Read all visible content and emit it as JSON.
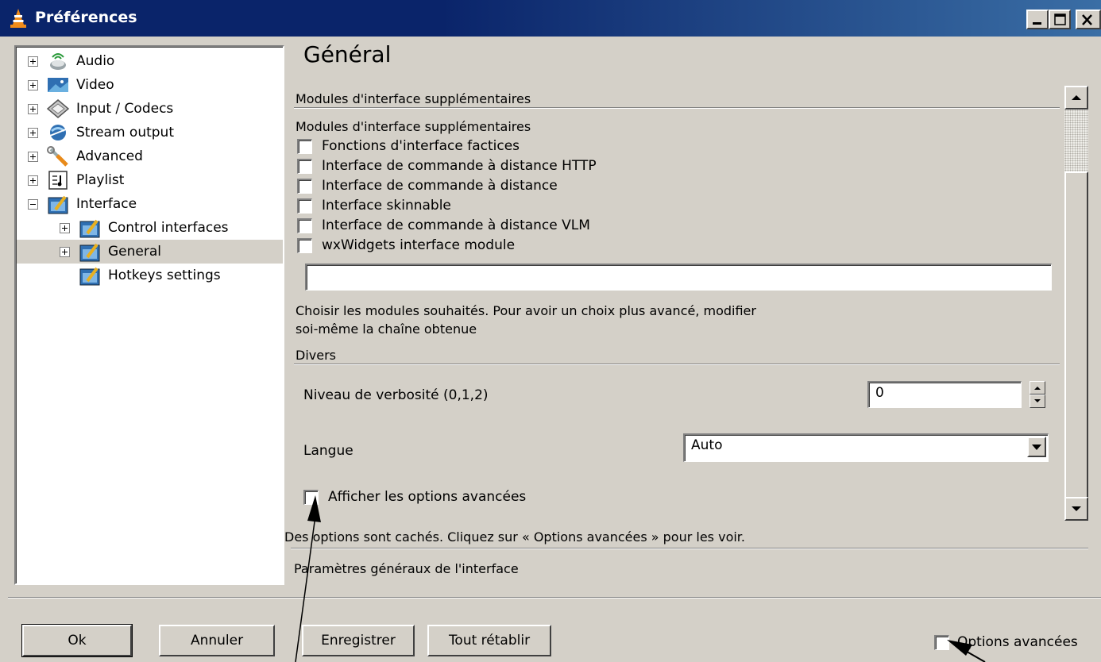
{
  "window": {
    "title": "Préférences",
    "icon": "vlc-cone-icon",
    "controls": [
      "minimize-icon",
      "maximize-icon",
      "close-icon"
    ]
  },
  "tree": {
    "items": [
      {
        "label": "Audio",
        "icon": "audio-icon",
        "expander": "plus",
        "level": 0
      },
      {
        "label": "Video",
        "icon": "video-icon",
        "expander": "plus",
        "level": 0
      },
      {
        "label": "Input / Codecs",
        "icon": "codecs-icon",
        "expander": "plus",
        "level": 0
      },
      {
        "label": "Stream output",
        "icon": "stream-output-icon",
        "expander": "plus",
        "level": 0
      },
      {
        "label": "Advanced",
        "icon": "advanced-icon",
        "expander": "plus",
        "level": 0
      },
      {
        "label": "Playlist",
        "icon": "playlist-icon",
        "expander": "plus",
        "level": 0
      },
      {
        "label": "Interface",
        "icon": "interface-icon",
        "expander": "minus",
        "level": 0
      },
      {
        "label": "Control interfaces",
        "icon": "interface-icon",
        "expander": "plus",
        "level": 1
      },
      {
        "label": "General",
        "icon": "interface-icon",
        "expander": "plus",
        "level": 1,
        "selected": true
      },
      {
        "label": "Hotkeys settings",
        "icon": "interface-icon",
        "expander": "none",
        "level": 1
      }
    ]
  },
  "panel": {
    "heading": "Général",
    "section1_title": "Modules d'interface supplémentaires",
    "modules_label": "Modules d'interface supplémentaires",
    "modules": [
      {
        "label": "Fonctions d'interface factices",
        "checked": false
      },
      {
        "label": "Interface de commande à distance HTTP",
        "checked": false
      },
      {
        "label": "Interface de commande à distance",
        "checked": false
      },
      {
        "label": "Interface skinnable",
        "checked": false
      },
      {
        "label": "Interface de commande à distance VLM",
        "checked": false
      },
      {
        "label": "wxWidgets interface module",
        "checked": false
      }
    ],
    "modules_value": "",
    "help_line1": "Choisir les modules souhaités. Pour avoir un choix plus avancé, modifier",
    "help_line2": "soi-même la chaîne obtenue",
    "section2_title": "Divers",
    "verbosity_label": "Niveau de verbosité (0,1,2)",
    "verbosity_value": "0",
    "language_label": "Langue",
    "language_value": "Auto",
    "show_advanced_label": "Afficher les options avancées",
    "show_advanced_checked": false,
    "hidden_notice": "Des options sont cachés. Cliquez sur « Options avancées » pour les voir.",
    "description": "Paramètres généraux de l'interface"
  },
  "footer": {
    "ok": "Ok",
    "cancel": "Annuler",
    "save": "Enregistrer",
    "reset": "Tout rétablir",
    "advanced_options": "Options avancées",
    "advanced_options_checked": false
  }
}
